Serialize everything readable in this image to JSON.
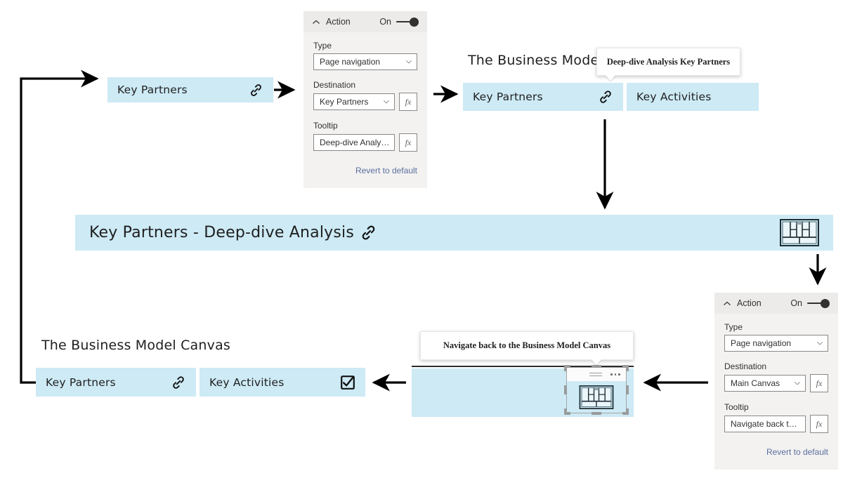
{
  "flow": {
    "step1_cell": {
      "label": "Key Partners",
      "icon": "link-icon"
    },
    "step2_canvas_title": "The Business Model Canvas",
    "step2_cells": [
      {
        "label": "Key Partners",
        "icon": "link-icon"
      },
      {
        "label": "Key Activities",
        "icon": "none"
      }
    ],
    "step2_tooltip": "Deep-dive Analysis Key Partners",
    "step3_banner": {
      "label": "Key Partners - Deep-dive Analysis",
      "icon": "link-icon",
      "thumb_icon": "canvas-layout-icon"
    },
    "step4_tooltip": "Navigate back to the Business Model Canvas",
    "step4_widget": {
      "menu_icon": "hamburger-icon",
      "more_icon": "more-options-icon",
      "image_icon": "canvas-layout-icon"
    },
    "step5_canvas_title": "The Business Model Canvas",
    "step5_cells": [
      {
        "label": "Key Partners",
        "icon": "link-icon"
      },
      {
        "label": "Key Activities",
        "icon": "checkbox-checked-icon"
      }
    ]
  },
  "pane_top": {
    "header": {
      "title": "Action",
      "state_label": "On",
      "collapse_icon": "chevron-up-icon",
      "toggle_icon": "toggle-on-icon"
    },
    "type": {
      "label": "Type",
      "value": "Page navigation",
      "dropdown_icon": "chevron-down-icon"
    },
    "destination": {
      "label": "Destination",
      "value": "Key Partners",
      "dropdown_icon": "chevron-down-icon",
      "fx_label": "fx"
    },
    "tooltip": {
      "label": "Tooltip",
      "value": "Deep-dive Analysi...",
      "fx_label": "fx"
    },
    "revert_label": "Revert to default"
  },
  "pane_bottom": {
    "header": {
      "title": "Action",
      "state_label": "On",
      "collapse_icon": "chevron-up-icon",
      "toggle_icon": "toggle-on-icon"
    },
    "type": {
      "label": "Type",
      "value": "Page navigation",
      "dropdown_icon": "chevron-down-icon"
    },
    "destination": {
      "label": "Destination",
      "value": "Main Canvas",
      "dropdown_icon": "chevron-down-icon",
      "fx_label": "fx"
    },
    "tooltip": {
      "label": "Tooltip",
      "value": "Navigate back to ...",
      "fx_label": "fx"
    },
    "revert_label": "Revert to default"
  },
  "colors": {
    "cell_fill": "#cdeaf5",
    "pane_bg": "#f3f2f1",
    "pane_header_bg": "#edebe9",
    "link_color": "#5b6f9e",
    "arrow_color": "#000000"
  }
}
